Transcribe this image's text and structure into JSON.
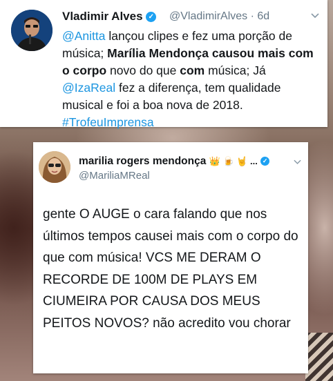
{
  "tweet1": {
    "name": "Vladimir Alves",
    "handle": "@VladimirAlves",
    "separator": "·",
    "time": "6d",
    "segments": {
      "s1": "@Anitta",
      "s2": " lançou clipes e fez uma porção de música; ",
      "s3": "Marília Mendonça",
      "s4": " ",
      "s5": "causou mais com o corpo",
      "s6": " novo do que ",
      "s7": "com",
      "s8": " música; Já ",
      "s9": "@IzaReal",
      "s10": " fez a diferença, tem qualidade musical e foi a boa nova de 2018."
    },
    "hashtag": "#TrofeuImprensa"
  },
  "tweet2": {
    "name": "marilia rogers mendonça",
    "name_emojis": "👑 🍺 🤘 ...",
    "handle": "@MariliaMReal",
    "text": "gente O AUGE o cara falando que nos últimos tempos causei mais com o corpo do que com música! VCS ME DERAM O RECORDE DE 100M DE PLAYS EM CIUMEIRA POR CAUSA DOS MEUS PEITOS NOVOS? não acredito vou chorar"
  },
  "icons": {
    "verified": "verified-check-icon",
    "chevron": "chevron-down-icon"
  },
  "colors": {
    "link": "#1b95e0",
    "verified": "#1da1f2",
    "handle": "#657786"
  }
}
